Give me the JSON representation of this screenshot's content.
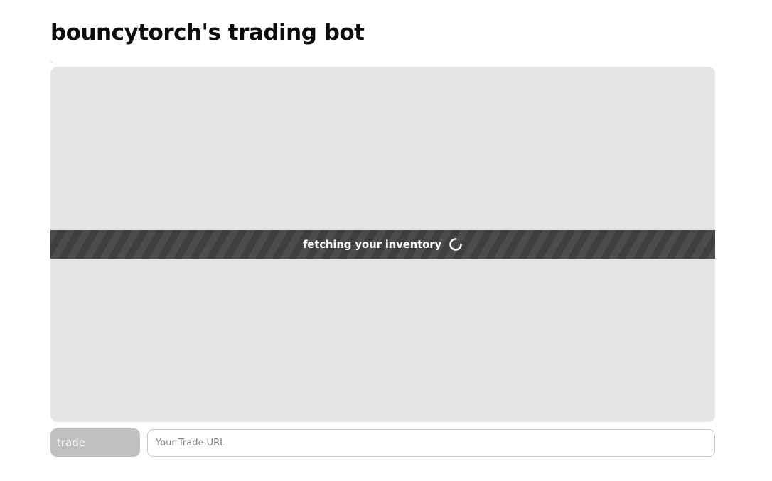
{
  "page": {
    "title": "bouncytorch's trading bot"
  },
  "inventory": {
    "loading_text": "fetching your inventory",
    "loading_icon": "spinner-icon"
  },
  "trade_form": {
    "button_label": "trade",
    "url_value": "",
    "url_placeholder": "Your Trade URL"
  },
  "colors": {
    "panel_background": "#e5e5e5",
    "loading_bar": "#444444",
    "button_disabled": "#c0c0c0"
  }
}
